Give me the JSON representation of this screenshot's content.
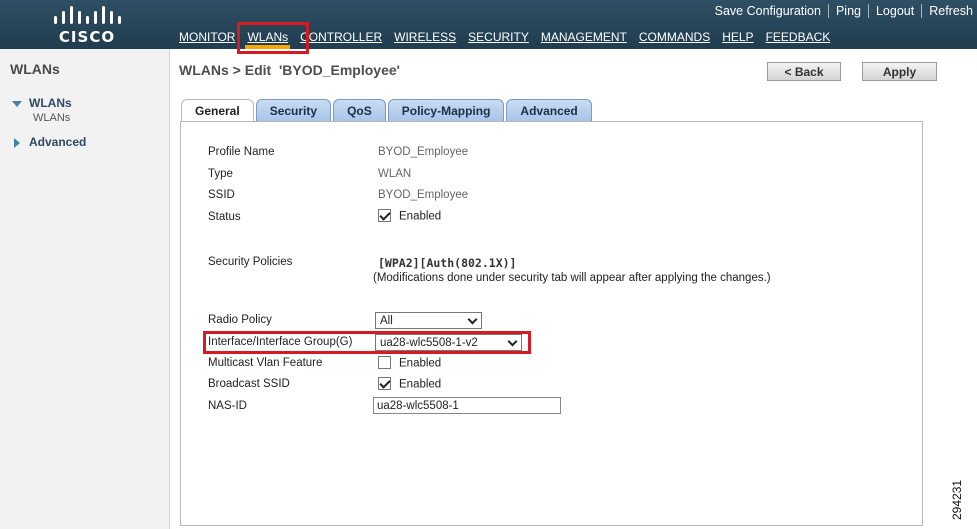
{
  "header": {
    "logo_text": "CISCO",
    "utility_links": [
      "Save Configuration",
      "Ping",
      "Logout",
      "Refresh"
    ],
    "nav": [
      "MONITOR",
      "WLANs",
      "CONTROLLER",
      "WIRELESS",
      "SECURITY",
      "MANAGEMENT",
      "COMMANDS",
      "HELP",
      "FEEDBACK"
    ],
    "active_nav": "WLANs"
  },
  "sidebar": {
    "title": "WLANs",
    "groups": [
      {
        "label": "WLANs",
        "expanded": true,
        "children": [
          "WLANs"
        ]
      },
      {
        "label": "Advanced",
        "expanded": false,
        "children": []
      }
    ]
  },
  "page": {
    "title": "WLANs > Edit  'BYOD_Employee'",
    "back_label": "< Back",
    "apply_label": "Apply"
  },
  "tabs": [
    "General",
    "Security",
    "QoS",
    "Policy-Mapping",
    "Advanced"
  ],
  "active_tab": "General",
  "form": {
    "profile_name_label": "Profile Name",
    "profile_name_value": "BYOD_Employee",
    "type_label": "Type",
    "type_value": "WLAN",
    "ssid_label": "SSID",
    "ssid_value": "BYOD_Employee",
    "status_label": "Status",
    "status_checked": true,
    "status_text": "Enabled",
    "security_policies_label": "Security Policies",
    "security_policies_value": "[WPA2][Auth(802.1X)]",
    "security_note": "(Modifications done under security tab will appear after applying the changes.)",
    "radio_policy_label": "Radio Policy",
    "radio_policy_value": "All",
    "interface_label": "Interface/Interface Group(G)",
    "interface_value": "ua28-wlc5508-1-v2",
    "multicast_label": "Multicast Vlan Feature",
    "multicast_checked": false,
    "multicast_text": "Enabled",
    "broadcast_label": "Broadcast SSID",
    "broadcast_checked": true,
    "broadcast_text": "Enabled",
    "nas_id_label": "NAS-ID",
    "nas_id_value": "ua28-wlc5508-1"
  },
  "figure_number": "294231",
  "colors": {
    "header_bg": "#264457",
    "highlight_red": "#d51a22",
    "active_underline": "#f7a800",
    "tab_blue": "#a6c4ea"
  }
}
